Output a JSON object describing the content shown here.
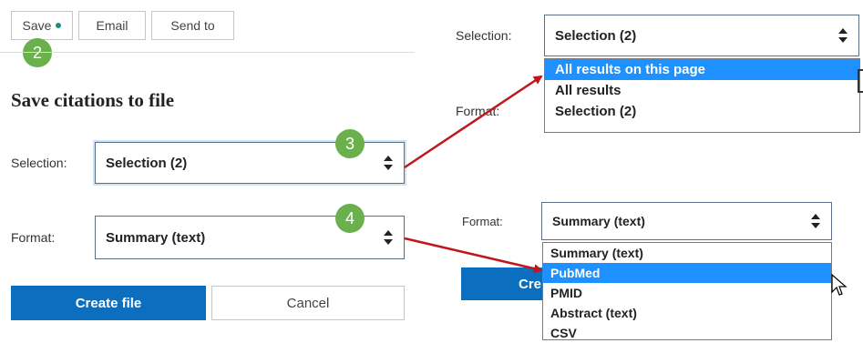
{
  "tabs": {
    "save_label": "Save",
    "email_label": "Email",
    "send_to_label": "Send to"
  },
  "callouts": {
    "step2": "2",
    "step3": "3",
    "step4": "4"
  },
  "panel": {
    "heading": "Save citations to file",
    "selection_label": "Selection:",
    "selection_value": "Selection (2)",
    "format_label": "Format:",
    "format_value": "Summary (text)",
    "create_button": "Create file",
    "cancel_button": "Cancel"
  },
  "selection_dropdown": {
    "label": "Selection:",
    "value": "Selection (2)",
    "hidden_label": "Format:",
    "options": [
      "All results on this page",
      "All results",
      "Selection (2)"
    ],
    "highlighted": "All results on this page"
  },
  "format_dropdown": {
    "label": "Format:",
    "value": "Summary (text)",
    "hidden_button": "Cre",
    "options": [
      "Summary (text)",
      "PubMed",
      "PMID",
      "Abstract (text)",
      "CSV"
    ],
    "highlighted": "PubMed"
  },
  "colors": {
    "accent_blue": "#0b6ebf",
    "highlight": "#1e90ff",
    "callout_green": "#6ab04c",
    "arrow_red": "#c0161c",
    "dot_teal": "#1a8d7e"
  }
}
